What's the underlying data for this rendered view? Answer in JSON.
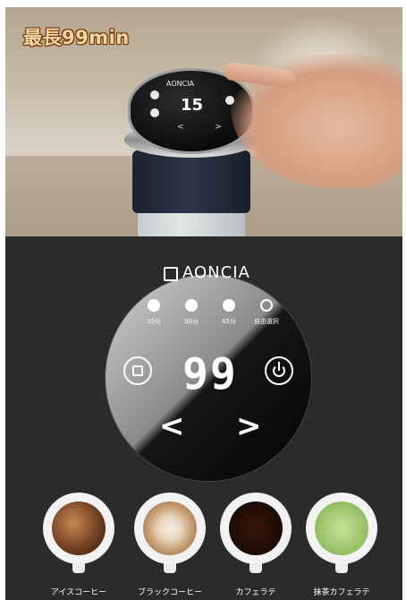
{
  "promo": {
    "text": "最長99min"
  },
  "device_photo": {
    "brand": "AONCIA",
    "display_digits": "15",
    "nav_arrows": "< >"
  },
  "panel": {
    "brand": "AONCIA",
    "modes": [
      {
        "label": "15分",
        "icon": "bean-icon"
      },
      {
        "label": "30分",
        "icon": "bean-icon"
      },
      {
        "label": "45分",
        "icon": "bean-icon"
      },
      {
        "label": "自由選択",
        "icon": "clock-icon"
      }
    ],
    "display_digits": "99",
    "arrow_left": "<",
    "arrow_right": ">",
    "left_button_icon": "brew-icon",
    "right_button_icon": "power-icon"
  },
  "cups": [
    {
      "label": "アイスコーヒー",
      "color": "#6b3a1f"
    },
    {
      "label": "ブラックコーヒー",
      "color": "#c9a27a"
    },
    {
      "label": "カフェラテ",
      "color": "#1a0b05"
    },
    {
      "label": "抹茶カフェラテ",
      "color": "#9bc36a"
    }
  ]
}
